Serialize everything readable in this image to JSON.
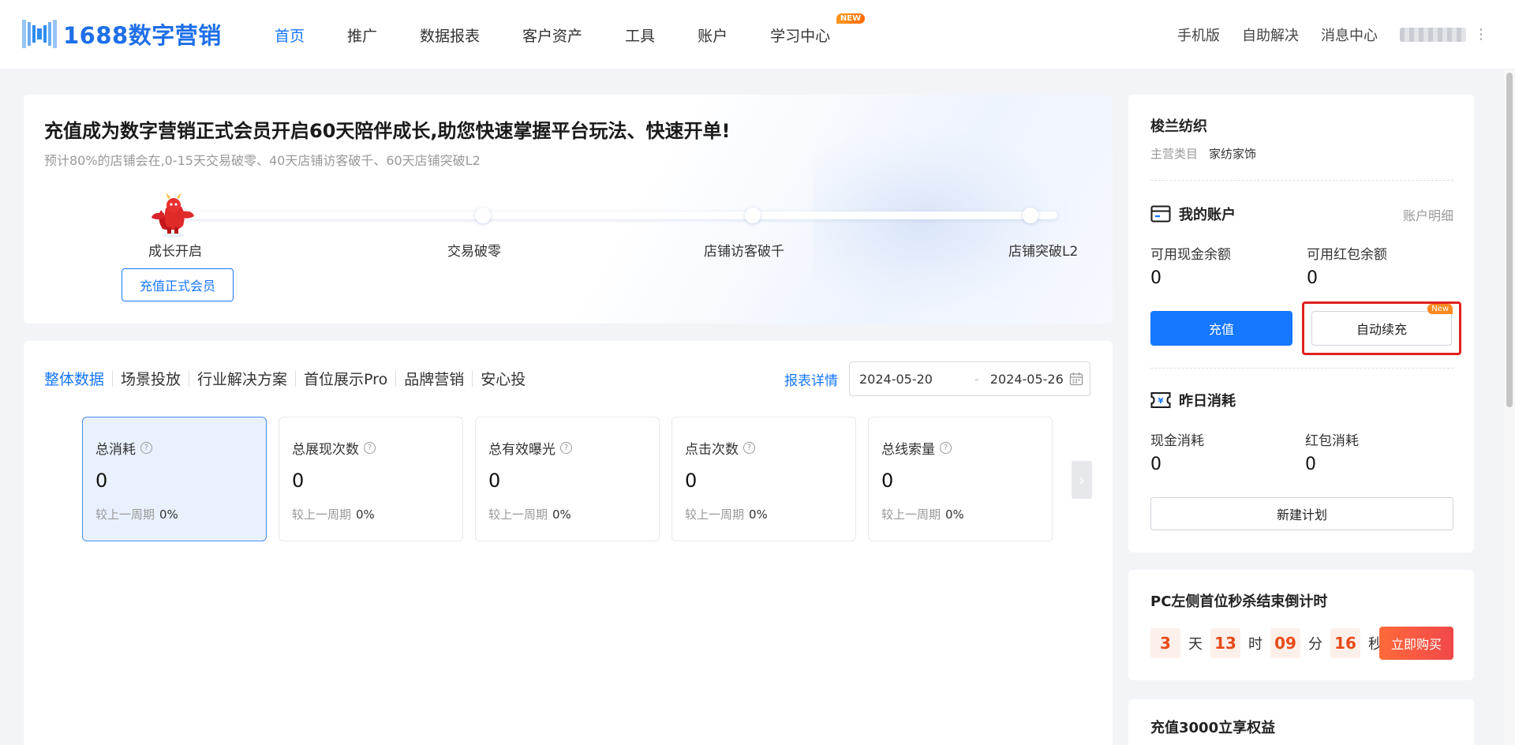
{
  "header": {
    "logo_text": "1688数字营销",
    "nav": [
      {
        "label": "首页",
        "active": true
      },
      {
        "label": "推广"
      },
      {
        "label": "数据报表"
      },
      {
        "label": "客户资产"
      },
      {
        "label": "工具"
      },
      {
        "label": "账户"
      },
      {
        "label": "学习中心",
        "badge": "NEW"
      }
    ],
    "right_links": [
      "手机版",
      "自助解决",
      "消息中心"
    ]
  },
  "banner": {
    "title": "充值成为数字营销正式会员开启60天陪伴成长,助您快速掌握平台玩法、快速开单!",
    "subtitle": "预计80%的店铺会在,0-15天交易破零、40天店铺访客破千、60天店铺突破L2",
    "steps": [
      "成长开启",
      "交易破零",
      "店铺访客破千",
      "店铺突破L2"
    ],
    "cta": "充值正式会员"
  },
  "data_panel": {
    "tabs": [
      "整体数据",
      "场景投放",
      "行业解决方案",
      "首位展示Pro",
      "品牌营销",
      "安心投"
    ],
    "report_link": "报表详情",
    "date_start": "2024-05-20",
    "date_sep": "-",
    "date_end": "2024-05-26",
    "metrics": [
      {
        "label": "总消耗",
        "value": "0",
        "compare_label": "较上一周期",
        "compare": "0%"
      },
      {
        "label": "总展现次数",
        "value": "0",
        "compare_label": "较上一周期",
        "compare": "0%"
      },
      {
        "label": "总有效曝光",
        "value": "0",
        "compare_label": "较上一周期",
        "compare": "0%"
      },
      {
        "label": "点击次数",
        "value": "0",
        "compare_label": "较上一周期",
        "compare": "0%"
      },
      {
        "label": "总线索量",
        "value": "0",
        "compare_label": "较上一周期",
        "compare": "0%"
      }
    ]
  },
  "account": {
    "shop_name": "梭兰纺织",
    "category_label": "主营类目",
    "category_value": "家纺家饰",
    "my_account_title": "我的账户",
    "account_detail": "账户明细",
    "cash_label": "可用现金余额",
    "cash_value": "0",
    "coupon_label": "可用红包余额",
    "coupon_value": "0",
    "recharge_btn": "充值",
    "auto_recharge_btn": "自动续充",
    "auto_recharge_tag": "New",
    "yesterday_title": "昨日消耗",
    "cash_cost_label": "现金消耗",
    "cash_cost_value": "0",
    "coupon_cost_label": "红包消耗",
    "coupon_cost_value": "0",
    "new_plan_btn": "新建计划"
  },
  "flash_sale": {
    "title": "PC左侧首位秒杀结束倒计时",
    "days": "3",
    "days_unit": "天",
    "hours": "13",
    "hours_unit": "时",
    "minutes": "09",
    "minutes_unit": "分",
    "seconds": "16",
    "seconds_unit": "秒",
    "buy_btn": "立即购买"
  },
  "recharge_promo": {
    "title": "充值3000立享权益"
  },
  "colors": {
    "accent": "#1677ff",
    "highlight": "#e02020",
    "countdown": "#e84b1a"
  }
}
